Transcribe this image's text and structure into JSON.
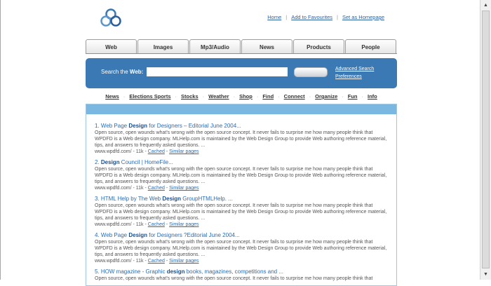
{
  "header": {
    "links": [
      "Home",
      "Add to Favourites",
      "Set as Homepage"
    ]
  },
  "tabs": [
    "Web",
    "Images",
    "Mp3/Audio",
    "News",
    "Products",
    "People"
  ],
  "search": {
    "label_prefix": "Search the ",
    "label_bold": "Web:",
    "input_value": "",
    "button_label": "",
    "advanced_link": "Advanced Search",
    "preferences_link": "Preferences"
  },
  "subnav": [
    "News",
    "Elections Sports",
    "Stocks",
    "Weather",
    "Shop",
    "Find",
    "Connect",
    "Organize",
    "Fun",
    "Info"
  ],
  "results": [
    {
      "num": "1.",
      "pre": "Web Page ",
      "bold": "Design",
      "post": " for Designers – Editorial June 2004...",
      "snippet": "Open source, open wounds what's wrong with the open source concept. It never fails to surprise me how many people think that WPDFD is a Web design company. MLHelp.com is maintained by the Web Design Group to provide Web authoring reference material, tips, and answers to frequently asked questions. ...",
      "url": "www.wpdfd.com/ - 11k - ",
      "cached": "Cached",
      "similar": "Similar pages"
    },
    {
      "num": "2.",
      "pre": "",
      "bold": "Design",
      "post": " Council | HomeFile...",
      "snippet": "Open source, open wounds what's wrong with the open source concept. It never fails to surprise me how many people think that WPDFD is a Web design company. MLHelp.com is maintained by the Web Design Group to provide Web authoring reference material, tips, and answers to frequently asked questions. ...",
      "url": "www.wpdfd.com/ - 11k - ",
      "cached": "Cached",
      "similar": "Similar pages"
    },
    {
      "num": "3.",
      "pre": "HTML Help by The Web ",
      "bold": "Design",
      "post": " GroupHTMLHelp. ...",
      "snippet": "Open source, open wounds what's wrong with the open source concept. It never fails to surprise me how many people think that WPDFD is a Web design company. MLHelp.com is maintained by the Web Design Group to provide Web authoring reference material, tips, and answers to frequently asked questions. ...",
      "url": "www.wpdfd.com/ - 11k - ",
      "cached": "Cached",
      "similar": "Similar pages"
    },
    {
      "num": "4.",
      "pre": "Web Page ",
      "bold": "Design",
      "post": " for Designers ?Editorial June 2004...",
      "snippet": "Open source, open wounds what's wrong with the open source concept. It never fails to surprise me how many people think that WPDFD is a Web design company. MLHelp.com is maintained by the Web Design Group to provide Web authoring reference material, tips, and answers to frequently asked questions. ...",
      "url": "www.wpdfd.com/ - 11k - ",
      "cached": "Cached",
      "similar": "Similar pages"
    },
    {
      "num": "5.",
      "pre": "HOW magazine - Graphic ",
      "bold": "design",
      "post": " books, magazines, competitions and ...",
      "snippet": "Open source, open wounds what's wrong with the open source concept. It never fails to surprise me how many people think that",
      "url": "",
      "cached": "",
      "similar": ""
    }
  ],
  "colors": {
    "search_bg": "#3a79b3",
    "results_bar": "#7ab8e2",
    "link": "#2b6cb0"
  }
}
